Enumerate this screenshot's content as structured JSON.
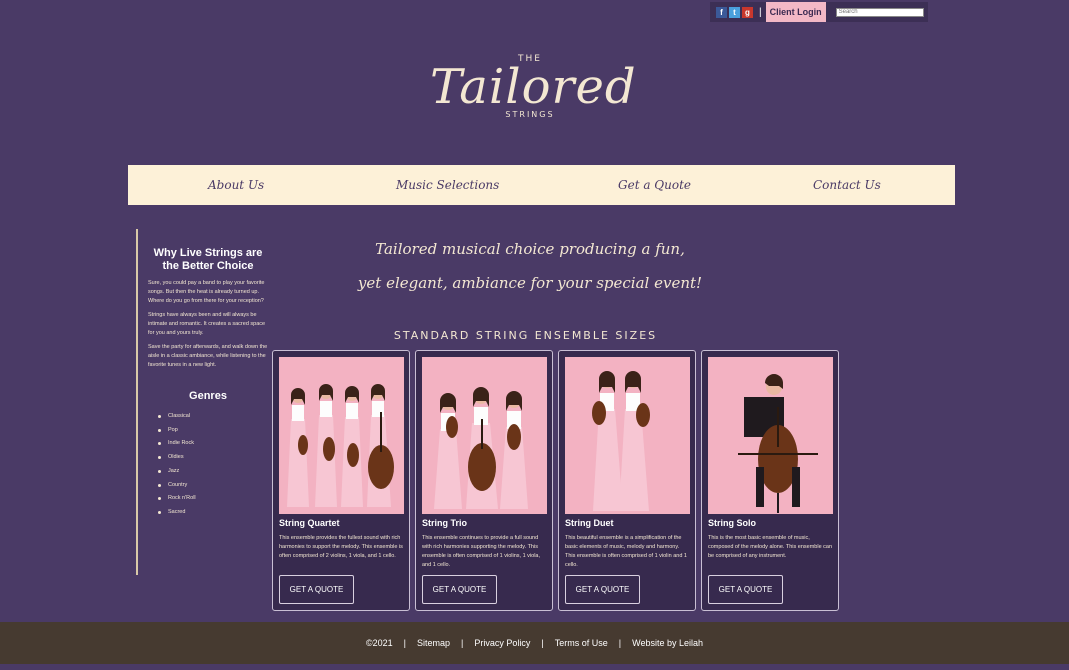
{
  "topbar": {
    "social_icons": [
      "facebook-icon",
      "twitter-icon",
      "google-plus-icon"
    ],
    "separator": "|",
    "client_login": "Client Login",
    "search_placeholder": "Search"
  },
  "logo": {
    "top": "THE",
    "main": "Tailored",
    "bottom": "STRINGS"
  },
  "nav": {
    "items": [
      {
        "label": "About Us"
      },
      {
        "label": "Music Selections"
      },
      {
        "label": "Get a Quote"
      },
      {
        "label": "Contact Us"
      }
    ]
  },
  "sidebar": {
    "title": "Why Live Strings are the Better Choice",
    "paragraphs": [
      "Sure, you could pay a band to play your favorite songs. But then the heat is already turned up. Where do you go from there for your reception?",
      "Strings have always been and will always be intimate and romantic. It creates a sacred space for you and yours truly.",
      "Save the party for afterwards, and walk down the aisle in a classic ambiance, while listening to the favorite tunes in a new light."
    ],
    "genres_title": "Genres",
    "genres": [
      "Classical",
      "Pop",
      "Indie Rock",
      "Oldies",
      "Jazz",
      "Country",
      "Rock n'Roll",
      "Sacred"
    ]
  },
  "main": {
    "tagline_line1": "Tailored musical choice producing a fun,",
    "tagline_line2": "yet elegant, ambiance for your special event!",
    "section_heading": "STANDARD STRING ENSEMBLE SIZES",
    "cards": [
      {
        "title": "String Quartet",
        "description": "This ensemble provides the fullest sound with rich harmonies to support the melody. This ensemble is often comprised of 2 violins, 1 viola, and 1 cello.",
        "button": "GET A QUOTE"
      },
      {
        "title": "String Trio",
        "description": "This ensemble continues to provide a full sound with rich harmonies supporting the melody. This ensemble is often comprised of 1 violins, 1 viola, and 1 cello.",
        "button": "GET A QUOTE"
      },
      {
        "title": "String Duet",
        "description": "This beautiful ensemble is a simplification of the basic elements of music, melody and harmony. This ensemble is often comprised of 1 violin and 1 cello.",
        "button": "GET A QUOTE"
      },
      {
        "title": "String Solo",
        "description": "This is the most basic ensemble of music, composed of the melody alone. This ensemble can be comprised of any instrument.",
        "button": "GET A QUOTE"
      }
    ]
  },
  "footer": {
    "copyright": "©2021",
    "sep": "|",
    "links": [
      "Sitemap",
      "Privacy Policy",
      "Terms of Use",
      "Website by Leilah"
    ]
  },
  "colors": {
    "background": "#4a3a66",
    "nav_bg": "#fdf1d8",
    "card_bg": "#372a4e",
    "photo_bg": "#f3b2c2",
    "footer_bg": "#463a30",
    "login_bg": "#f3b8c6"
  }
}
